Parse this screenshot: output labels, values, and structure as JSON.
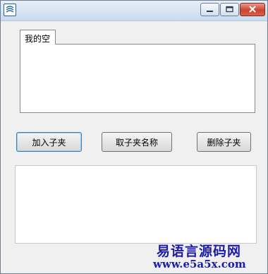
{
  "window": {
    "title": "",
    "icon": "app-icon",
    "controls": [
      "minimize-icon",
      "maximize-icon",
      "close-icon"
    ]
  },
  "tabs": [
    {
      "label": "我的空"
    }
  ],
  "buttons": {
    "add_child": "加入子夹",
    "get_child_name": "取子夹名称",
    "delete_child": "删除子夹"
  },
  "watermark": {
    "name": "易语言源码网",
    "url": "www.e5a5x.com",
    "color": "#1c1ca8"
  }
}
